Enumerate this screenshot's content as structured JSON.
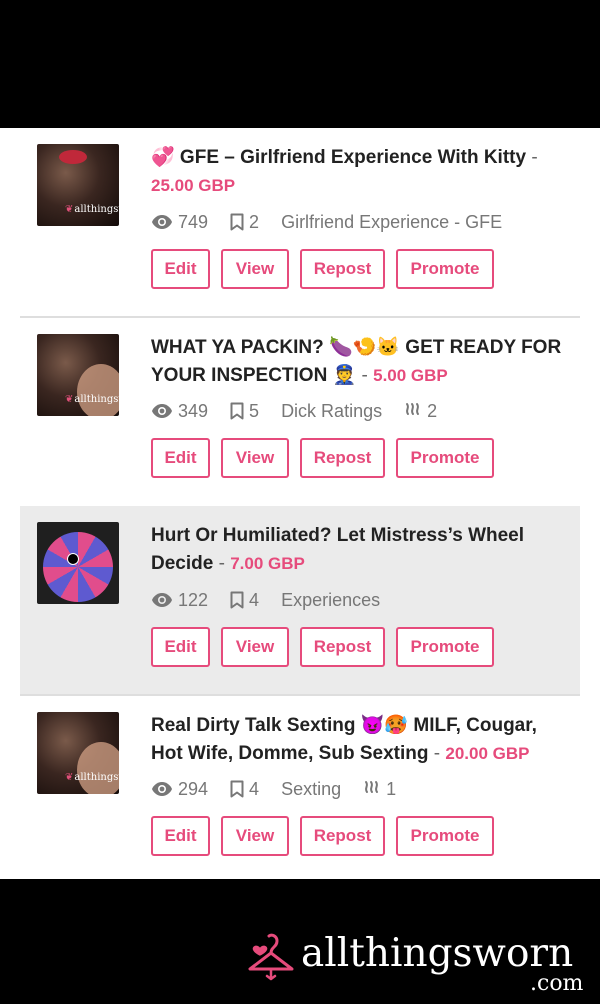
{
  "listings": [
    {
      "title": "💞 GFE – Girlfriend Experience With Kitty",
      "price": "25.00 GBP",
      "views": "749",
      "bookmarks": "2",
      "category": "Girlfriend Experience - GFE",
      "thumb_watermark": "allthingsworn"
    },
    {
      "title": "WHAT YA PACKIN? 🍆🍤🐱 GET READY FOR YOUR INSPECTION 👮",
      "price": "5.00 GBP",
      "views": "349",
      "bookmarks": "5",
      "category": "Dick Ratings",
      "heat": "2",
      "thumb_watermark": "allthingsworn"
    },
    {
      "title": "Hurt Or Humiliated? Let Mistress’s Wheel Decide",
      "price": "7.00 GBP",
      "views": "122",
      "bookmarks": "4",
      "category": "Experiences"
    },
    {
      "title": "Real Dirty Talk Sexting 😈🥵 MILF, Cougar, Hot Wife, Domme, Sub Sexting",
      "price": "20.00 GBP",
      "views": "294",
      "bookmarks": "4",
      "category": "Sexting",
      "heat": "1",
      "thumb_watermark": "allthingsworn"
    }
  ],
  "buttons": {
    "edit": "Edit",
    "view": "View",
    "repost": "Repost",
    "promote": "Promote"
  },
  "separator": "-",
  "brand": {
    "name": "allthingsworn",
    "tld": ".com"
  },
  "colors": {
    "accent": "#e64b7c",
    "highlight_row": "#ebebeb",
    "text": "#222222",
    "meta": "#777777"
  },
  "icons": {
    "views": "eye-icon",
    "bookmarks": "bookmark-icon",
    "heat": "heat-icon",
    "brand": "hanger-heart-icon"
  }
}
